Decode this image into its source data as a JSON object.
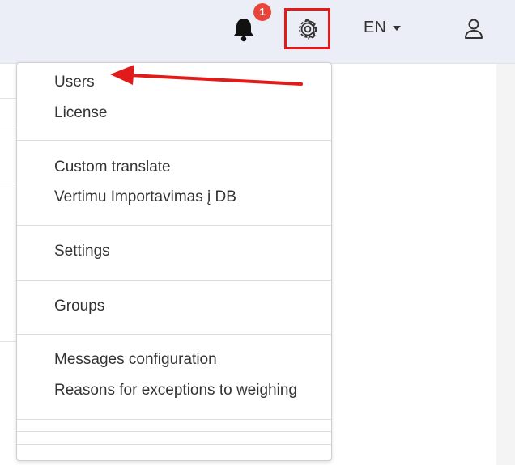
{
  "header": {
    "notification_count": "1",
    "language": "EN"
  },
  "menu": {
    "items": [
      "Users",
      "License",
      "Custom translate",
      "Vertimu Importavimas į DB",
      "Settings",
      "Groups",
      "Messages configuration",
      "Reasons for exceptions to weighing"
    ]
  },
  "icons": {
    "notification": "bell-icon",
    "settings": "gear-icon",
    "language_dropdown": "caret-down-icon",
    "account": "user-icon",
    "annotation": "red-arrow"
  },
  "colors": {
    "topbar_background": "#eceef7",
    "badge": "#e8443a",
    "highlight_box": "#e11a1a",
    "annotation_arrow": "#e11a1a",
    "menu_text": "#333333"
  }
}
